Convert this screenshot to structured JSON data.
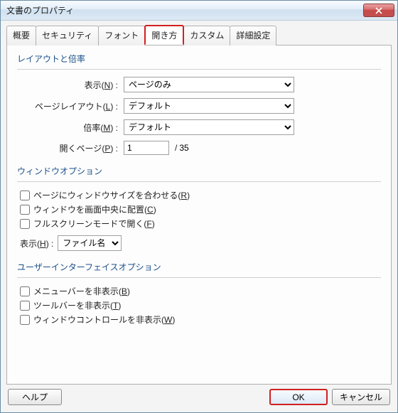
{
  "window": {
    "title": "文書のプロパティ"
  },
  "tabs": {
    "items": [
      {
        "label": "概要"
      },
      {
        "label": "セキュリティ"
      },
      {
        "label": "フォント"
      },
      {
        "label": "開き方"
      },
      {
        "label": "カスタム"
      },
      {
        "label": "詳細設定"
      }
    ],
    "active_index": 3
  },
  "layout_group": {
    "title": "レイアウトと倍率",
    "display": {
      "label": "表示",
      "key": "N",
      "value": "ページのみ"
    },
    "page_layout": {
      "label": "ページレイアウト",
      "key": "L",
      "value": "デフォルト"
    },
    "zoom": {
      "label": "倍率",
      "key": "M",
      "value": "デフォルト"
    },
    "open_page": {
      "label": "開くページ",
      "key": "P",
      "value": "1",
      "total": "35"
    }
  },
  "window_group": {
    "title": "ウィンドウオプション",
    "fit_window": {
      "label": "ページにウィンドウサイズを合わせる",
      "key": "R",
      "checked": false
    },
    "center": {
      "label": "ウィンドウを画面中央に配置",
      "key": "C",
      "checked": false
    },
    "fullscreen": {
      "label": "フルスクリーンモードで開く",
      "key": "F",
      "checked": false
    },
    "show": {
      "label": "表示",
      "key": "H",
      "value": "ファイル名"
    }
  },
  "ui_group": {
    "title": "ユーザーインターフェイスオプション",
    "hide_menu": {
      "label": "メニューバーを非表示",
      "key": "B",
      "checked": false
    },
    "hide_tool": {
      "label": "ツールバーを非表示",
      "key": "T",
      "checked": false
    },
    "hide_ctrl": {
      "label": "ウィンドウコントロールを非表示",
      "key": "W",
      "checked": false
    }
  },
  "buttons": {
    "help": "ヘルプ",
    "ok": "OK",
    "cancel": "キャンセル"
  }
}
